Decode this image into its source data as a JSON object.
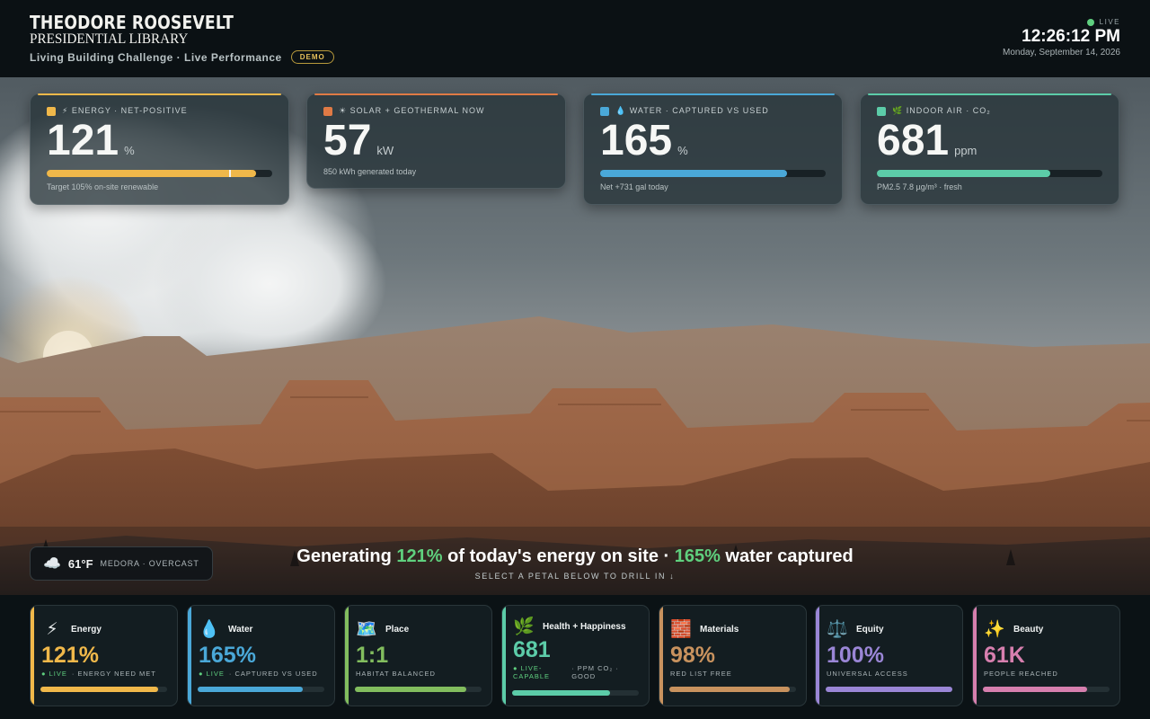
{
  "header": {
    "logo_line1": "THEODORE ROOSEVELT",
    "logo_line2": "PRESIDENTIAL LIBRARY",
    "subtitle": "Living Building Challenge · Live Performance",
    "badge": "DEMO",
    "live_label": "LIVE",
    "time": "12:26:12 PM",
    "date": "Monday, September 14, 2026"
  },
  "metrics": [
    {
      "label": "⚡ ENERGY · NET-POSITIVE",
      "value": "121",
      "unit": "%",
      "note": "Target 105% on-site renewable",
      "color": "#f0b84a",
      "fill_fraction": 0.93,
      "target_fraction": 0.81,
      "has_bar": true
    },
    {
      "label": "☀ SOLAR + GEOTHERMAL NOW",
      "value": "57",
      "unit": "kW",
      "note": "850 kWh generated today",
      "color": "#e07a45",
      "has_bar": false
    },
    {
      "label": "💧 WATER · CAPTURED VS USED",
      "value": "165",
      "unit": "%",
      "note": "Net +731 gal today",
      "color": "#4aa8d8",
      "fill_fraction": 0.83,
      "has_bar": true
    },
    {
      "label": "🌿 INDOOR AIR · CO₂",
      "value": "681",
      "unit": "ppm",
      "note": "PM2.5 7.8 µg/m³ · fresh",
      "color": "#5ccca8",
      "fill_fraction": 0.77,
      "has_bar": true
    }
  ],
  "weather": {
    "icon": "cloud-icon",
    "temp": "61°F",
    "location": "MEDORA · OVERCAST"
  },
  "headline": {
    "part1": "Generating ",
    "energy": "121%",
    "part2": " of today's energy on site · ",
    "water": "165%",
    "part3": " water captured",
    "sub": "SELECT A PETAL BELOW TO DRILL IN ↓",
    "highlight_color": "#5fd07e"
  },
  "petals": [
    {
      "name": "Energy",
      "icon": "lightning-icon",
      "glyph": "⚡",
      "value": "121%",
      "live": "● LIVE",
      "status": "· ENERGY NEED MET",
      "color": "#f0b84a",
      "fill_fraction": 0.93
    },
    {
      "name": "Water",
      "icon": "droplet-icon",
      "glyph": "💧",
      "value": "165%",
      "live": "● LIVE",
      "status": "· CAPTURED VS USED",
      "color": "#4aa8d8",
      "fill_fraction": 0.83
    },
    {
      "name": "Place",
      "icon": "map-icon",
      "glyph": "🗺️",
      "value": "1:1",
      "live": "",
      "status": "HABITAT BALANCED",
      "color": "#82bd5e",
      "fill_fraction": 0.88
    },
    {
      "name": "Health + Happiness",
      "icon": "herb-icon",
      "glyph": "🌿",
      "value": "681",
      "live": "● LIVE-CAPABLE",
      "status": "· PPM CO₂ · GOOD",
      "color": "#5ccca8",
      "fill_fraction": 0.77
    },
    {
      "name": "Materials",
      "icon": "brick-icon",
      "glyph": "🧱",
      "value": "98%",
      "live": "",
      "status": "RED LIST FREE",
      "color": "#c8925e",
      "fill_fraction": 0.95
    },
    {
      "name": "Equity",
      "icon": "scales-icon",
      "glyph": "⚖️",
      "value": "100%",
      "live": "",
      "status": "UNIVERSAL ACCESS",
      "color": "#9a86d6",
      "fill_fraction": 1.0
    },
    {
      "name": "Beauty",
      "icon": "sparkles-icon",
      "glyph": "✨",
      "value": "61K",
      "live": "",
      "status": "PEOPLE REACHED",
      "color": "#d67fae",
      "fill_fraction": 0.82
    }
  ]
}
